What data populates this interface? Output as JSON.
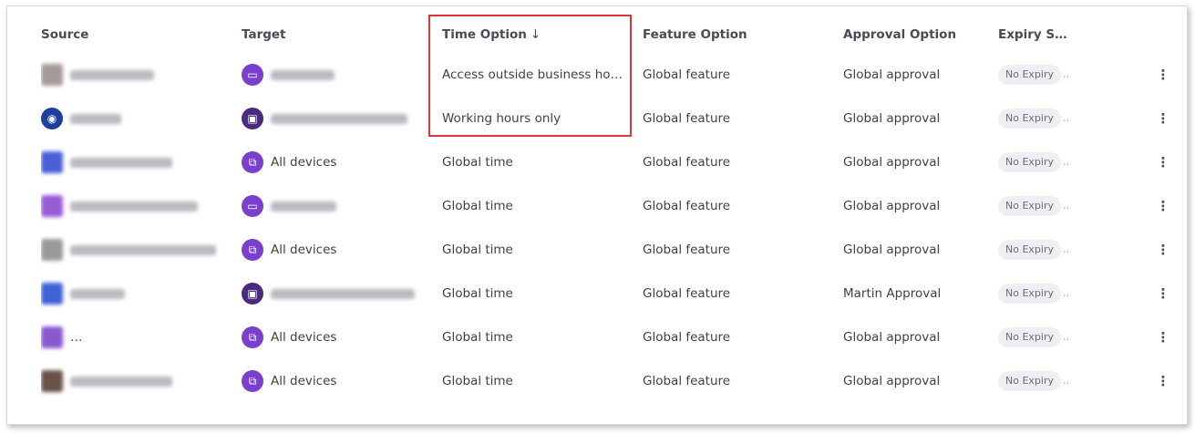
{
  "table": {
    "headers": {
      "source": "Source",
      "target": "Target",
      "time": "Time Option",
      "feature": "Feature Option",
      "approval": "Approval Option",
      "expiry": "Expiry St..."
    },
    "sort_indicator": "↓",
    "menu_glyph": "⋮",
    "rows": [
      {
        "target_label": "",
        "time": "Access outside business hours",
        "feature": "Global feature",
        "approval": "Global approval",
        "expiry": "No Expiry"
      },
      {
        "target_label": "",
        "time": "Working hours only",
        "feature": "Global feature",
        "approval": "Global approval",
        "expiry": "No Expiry"
      },
      {
        "target_label": "All devices",
        "time": "Global time",
        "feature": "Global feature",
        "approval": "Global approval",
        "expiry": "No Expiry"
      },
      {
        "target_label": "",
        "time": "Global time",
        "feature": "Global feature",
        "approval": "Global approval",
        "expiry": "No Expiry"
      },
      {
        "target_label": "All devices",
        "time": "Global time",
        "feature": "Global feature",
        "approval": "Global approval",
        "expiry": "No Expiry"
      },
      {
        "target_label": "",
        "time": "Global time",
        "feature": "Global feature",
        "approval": "Martin Approval",
        "expiry": "No Expiry"
      },
      {
        "target_label": "All devices",
        "time": "Global time",
        "feature": "Global feature",
        "approval": "Global approval",
        "expiry": "No Expiry"
      },
      {
        "target_label": "All devices",
        "time": "Global time",
        "feature": "Global feature",
        "approval": "Global approval",
        "expiry": "No Expiry"
      }
    ]
  },
  "colors": {
    "highlight": "#d9373b",
    "target_icon": "#7b3fcf",
    "target_icon_group": "#4b2c7c",
    "source_icon": "#1f3f9c"
  }
}
